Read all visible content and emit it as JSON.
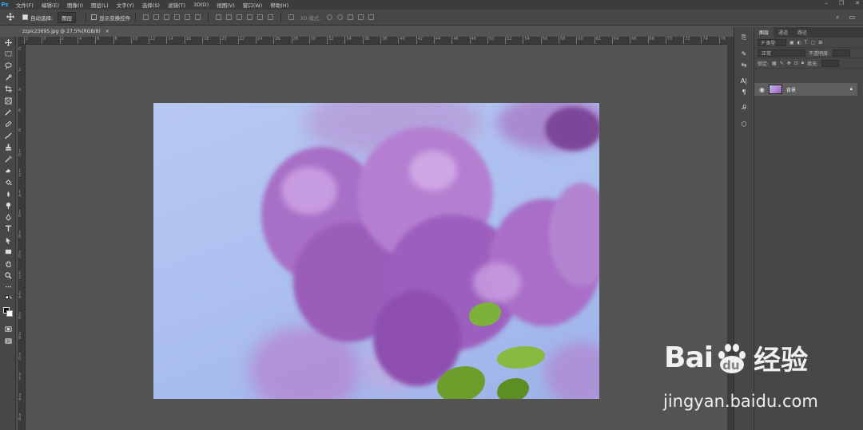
{
  "app": {
    "logo": "Ps"
  },
  "menu": [
    "文件(F)",
    "编辑(E)",
    "图像(I)",
    "图层(L)",
    "文字(Y)",
    "选择(S)",
    "滤镜(T)",
    "3D(D)",
    "视图(V)",
    "窗口(W)",
    "帮助(H)"
  ],
  "window_controls": {
    "minimize": "–",
    "restore": "❐",
    "close": "✕"
  },
  "options_bar": {
    "auto_select_label": "自动选择:",
    "auto_select_checked": true,
    "auto_select_value": "图层",
    "show_transform_label": "显示变换控件",
    "show_transform_checked": false,
    "mode_3d_label": "3D 模式:"
  },
  "document_tab": {
    "title": "zzpic23695.jpg @ 27.5%(RGB/8)",
    "close": "×"
  },
  "ruler_top_labels": [
    "2",
    "0",
    "2",
    "4",
    "6",
    "8",
    "10",
    "12",
    "14",
    "16",
    "18",
    "20",
    "22",
    "24",
    "26",
    "28",
    "30",
    "32",
    "34",
    "36",
    "38",
    "40",
    "42",
    "44",
    "46",
    "48",
    "50",
    "52",
    "54",
    "56",
    "58",
    "60",
    "62",
    "64",
    "66",
    "68",
    "70",
    "72",
    "74",
    "76"
  ],
  "ruler_left_labels": [
    "0",
    "2",
    "4",
    "6",
    "8",
    "1\n0",
    "1\n2",
    "1\n4",
    "1\n6",
    "1\n8",
    "2\n0",
    "2\n2",
    "2\n4",
    "2\n6",
    "2\n8",
    "3\n0",
    "3\n2",
    "3\n4",
    "3\n6"
  ],
  "layers_panel": {
    "tabs": [
      "图层",
      "通道",
      "路径"
    ],
    "kind_label": "P 类型",
    "blend_mode": "正常",
    "opacity_label": "不透明度:",
    "lock_label": "锁定:",
    "fill_label": "填充:",
    "layer_name": "背景"
  },
  "watermark": {
    "logo_text": "Bai",
    "logo_du": "du",
    "logo_cn": "经验",
    "url": "jingyan.baidu.com"
  }
}
